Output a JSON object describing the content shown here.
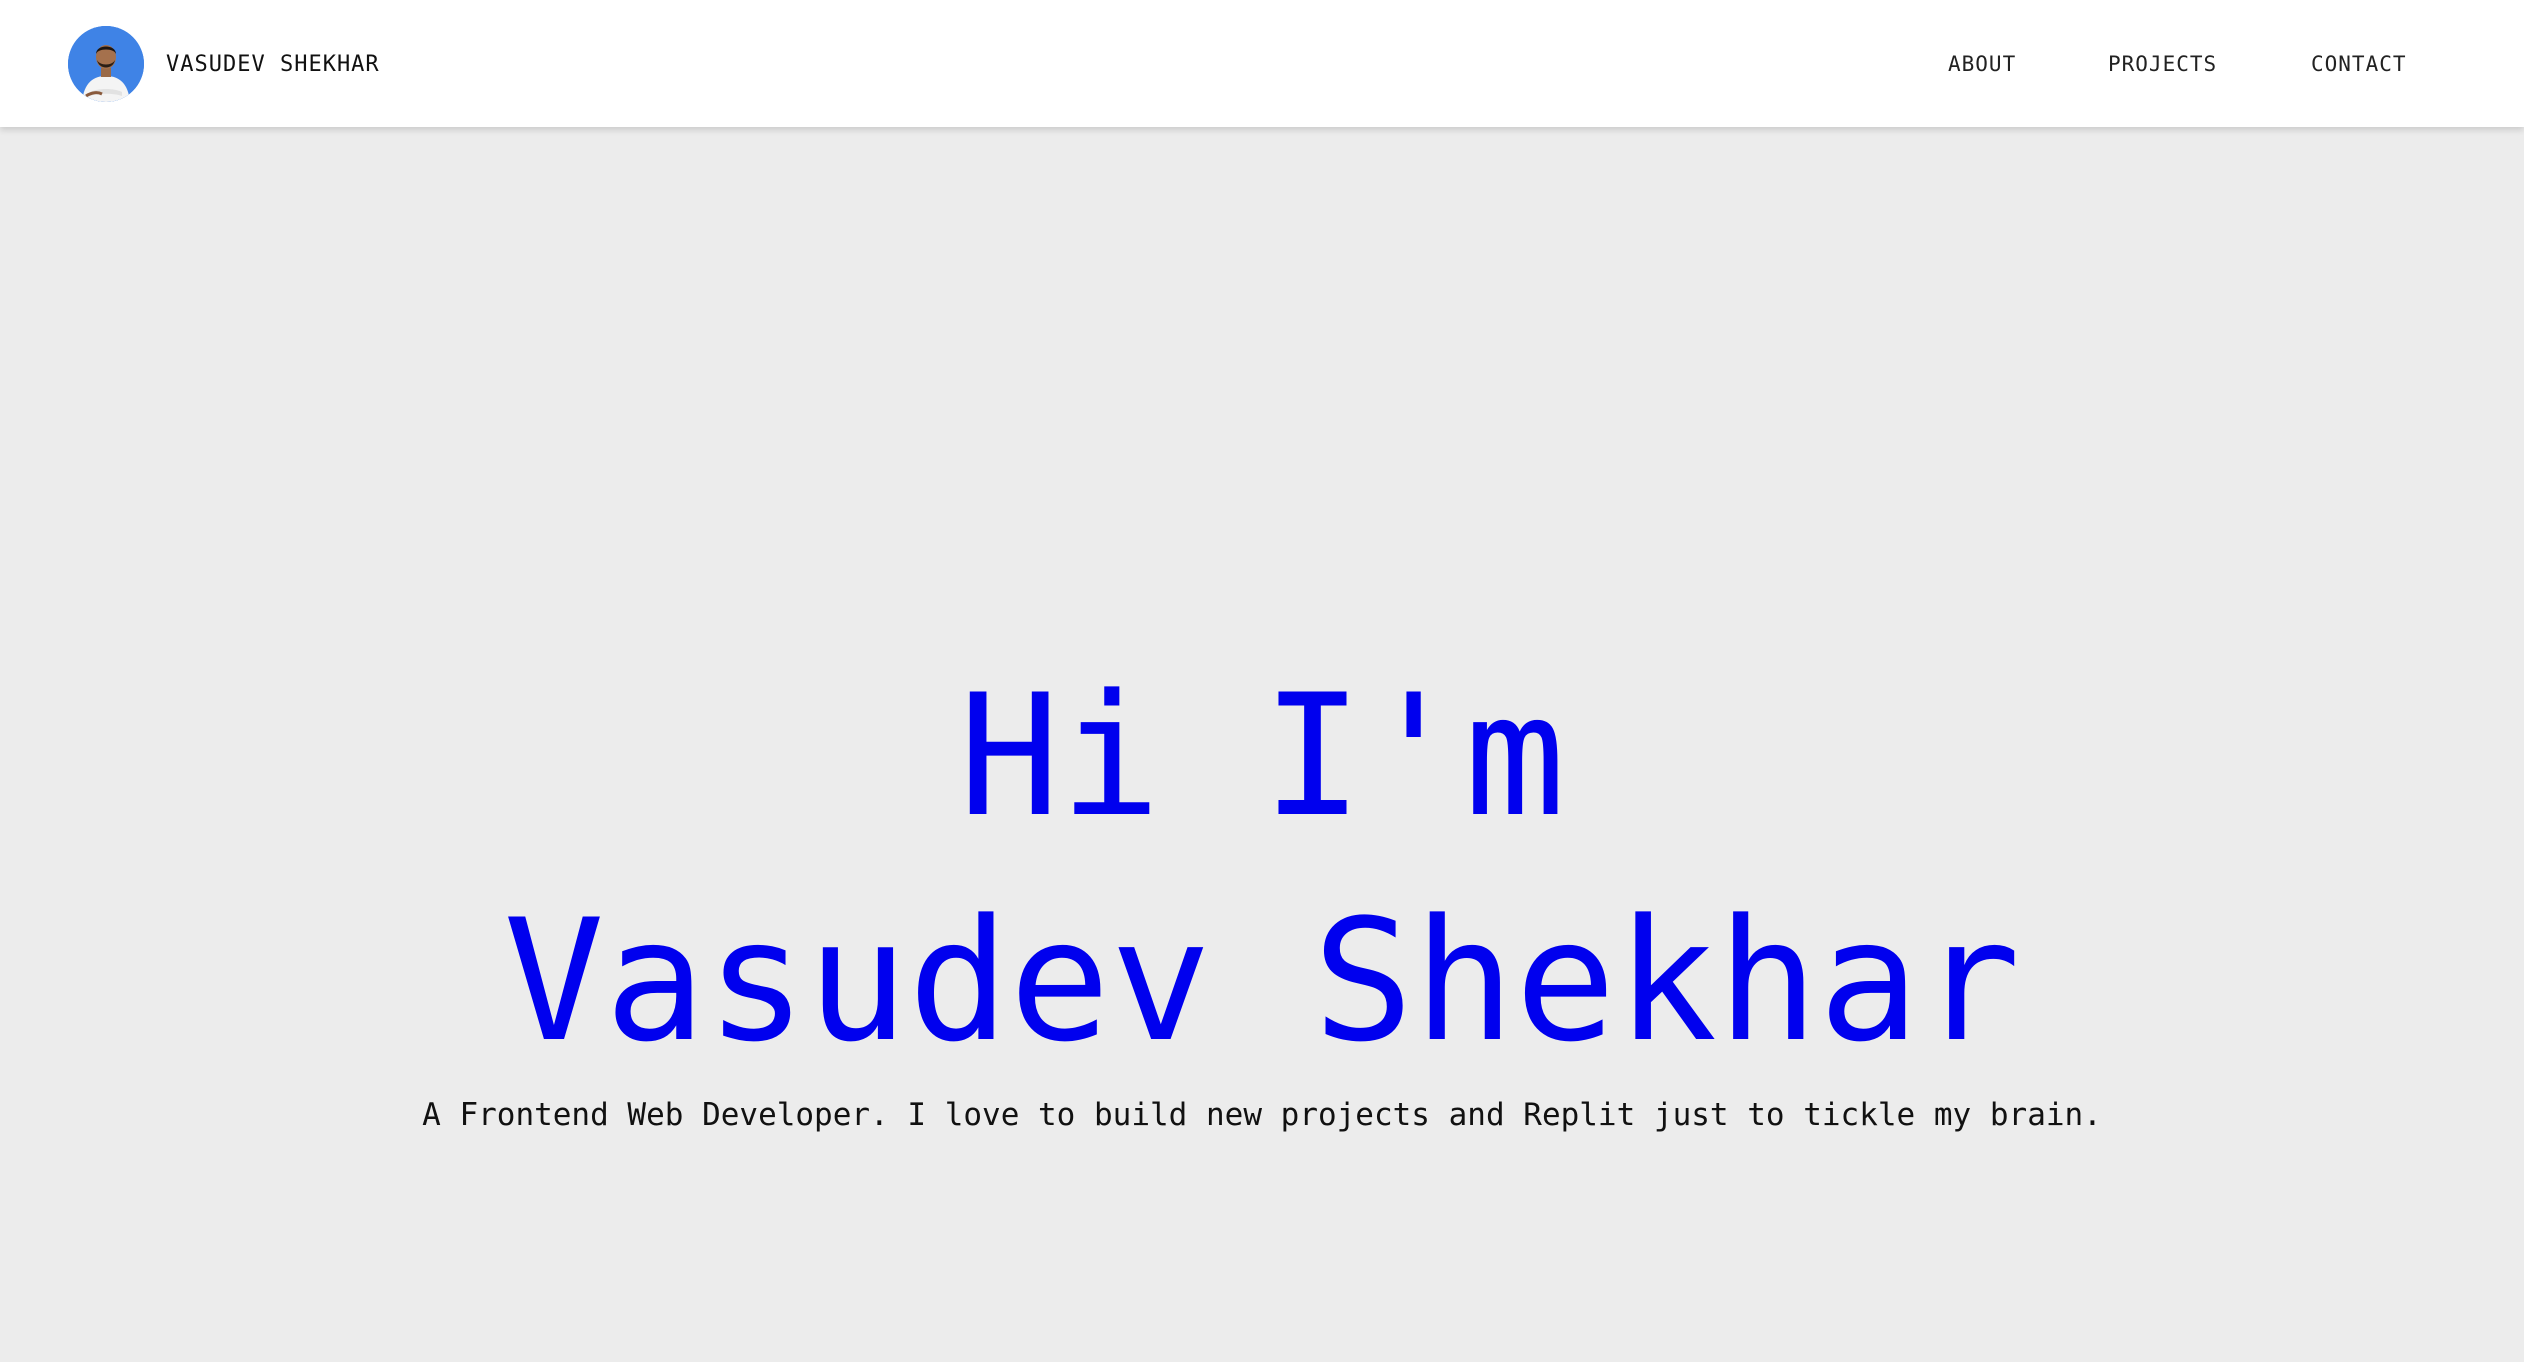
{
  "navbar": {
    "brand_name": "VASUDEV SHEKHAR",
    "avatar_icon": "profile-photo",
    "links": {
      "about": "ABOUT",
      "projects": "PROJECTS",
      "contact": "CONTACT"
    }
  },
  "hero": {
    "greeting": "Hi I'm",
    "name": "Vasudev Shekhar",
    "tagline": "A Frontend Web Developer. I love to build new projects and Replit just to tickle my brain."
  },
  "colors": {
    "accent": "#0000ee",
    "background": "#ececec",
    "navbar": "#ffffff",
    "avatar_bg": "#3f83e6"
  }
}
